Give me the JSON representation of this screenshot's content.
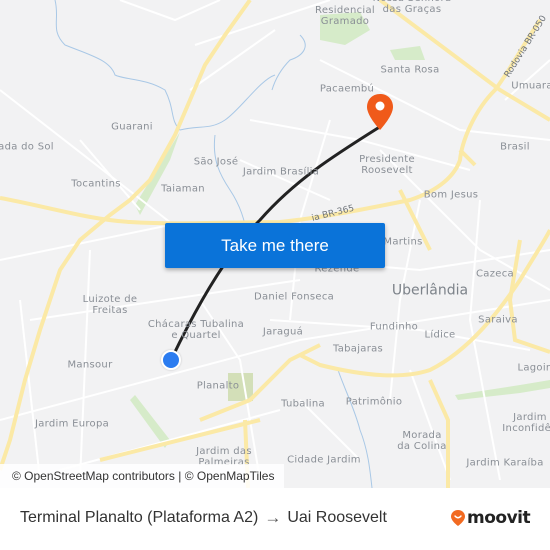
{
  "map": {
    "places": [
      {
        "name": "Residencial Gramado",
        "lines": [
          "Residencial",
          "Gramado"
        ]
      },
      {
        "name": "Nossa Senhora das Graças",
        "lines": [
          "Nossa Senhora",
          "das Graças"
        ]
      },
      {
        "name": "Santa Rosa",
        "lines": [
          "Santa Rosa"
        ]
      },
      {
        "name": "Pacaembú",
        "lines": [
          "Pacaembú"
        ]
      },
      {
        "name": "Umuarama",
        "lines": [
          "Umuara"
        ]
      },
      {
        "name": "Guarani",
        "lines": [
          "Guarani"
        ]
      },
      {
        "name": "Morada do Sol",
        "lines": [
          "ada do Sol"
        ]
      },
      {
        "name": "São José",
        "lines": [
          "São José"
        ]
      },
      {
        "name": "Jardim Brasília",
        "lines": [
          "Jardim Brasília"
        ]
      },
      {
        "name": "Presidente Roosevelt",
        "lines": [
          "Presidente",
          "Roosevelt"
        ]
      },
      {
        "name": "Brasil",
        "lines": [
          "Brasil"
        ]
      },
      {
        "name": "Tocantins",
        "lines": [
          "Tocantins"
        ]
      },
      {
        "name": "Taiaman",
        "lines": [
          "Taiaman"
        ]
      },
      {
        "name": "Bom Jesus",
        "lines": [
          "Bom Jesus"
        ]
      },
      {
        "name": "Martins",
        "lines": [
          "Martins"
        ]
      },
      {
        "name": "Rezende",
        "lines": [
          "Rezende"
        ]
      },
      {
        "name": "Cazeca",
        "lines": [
          "Cazeca"
        ]
      },
      {
        "name": "Uberlândia",
        "lines": [
          "Uberlândia"
        ]
      },
      {
        "name": "Luizote de Freitas",
        "lines": [
          "Luizote de",
          "Freitas"
        ]
      },
      {
        "name": "Daniel Fonseca",
        "lines": [
          "Daniel Fonseca"
        ]
      },
      {
        "name": "Saraiva",
        "lines": [
          "Saraiva"
        ]
      },
      {
        "name": "Chácaras Tubalina e Quartel",
        "lines": [
          "Chácaras Tubalina",
          "e Quartel"
        ]
      },
      {
        "name": "Jaraguá",
        "lines": [
          "Jaraguá"
        ]
      },
      {
        "name": "Fundinho",
        "lines": [
          "Fundinho"
        ]
      },
      {
        "name": "Lídice",
        "lines": [
          "Lídice"
        ]
      },
      {
        "name": "Mansour",
        "lines": [
          "Mansour"
        ]
      },
      {
        "name": "Tabajaras",
        "lines": [
          "Tabajaras"
        ]
      },
      {
        "name": "Lagoinha",
        "lines": [
          "Lagoin"
        ]
      },
      {
        "name": "Planalto",
        "lines": [
          "Planalto"
        ]
      },
      {
        "name": "Tubalina",
        "lines": [
          "Tubalina"
        ]
      },
      {
        "name": "Patrimônio",
        "lines": [
          "Patrimônio"
        ]
      },
      {
        "name": "Jardim Europa",
        "lines": [
          "Jardim Europa"
        ]
      },
      {
        "name": "Jardim Inconfidência",
        "lines": [
          "Jardim",
          "Inconfidên"
        ]
      },
      {
        "name": "Morada da Colina",
        "lines": [
          "Morada",
          "da Colina"
        ]
      },
      {
        "name": "Jardim das Palmeiras",
        "lines": [
          "Jardim das",
          "Palmeiras"
        ]
      },
      {
        "name": "Cidade Jardim",
        "lines": [
          "Cidade Jardim"
        ]
      },
      {
        "name": "Jardim Karaíba",
        "lines": [
          "Jardim Karaíba"
        ]
      }
    ],
    "road_labels": {
      "br365": "ia BR-365",
      "br050": "Rodovia BR-050"
    },
    "attribution": "© OpenStreetMap contributors | © OpenMapTiles",
    "colors": {
      "route_line": "#222222",
      "origin_marker": "#2b7cf0",
      "destination_marker": "#f05a1a",
      "highway": "#fbe9a6",
      "park": "#cfe8c0",
      "water": "#9ec3e6"
    }
  },
  "cta": {
    "label": "Take me there"
  },
  "footer": {
    "origin": "Terminal Planalto (Plataforma A2)",
    "arrow": "→",
    "destination": "Uai Roosevelt",
    "brand": "moovit",
    "brand_color": "#f26a21"
  }
}
